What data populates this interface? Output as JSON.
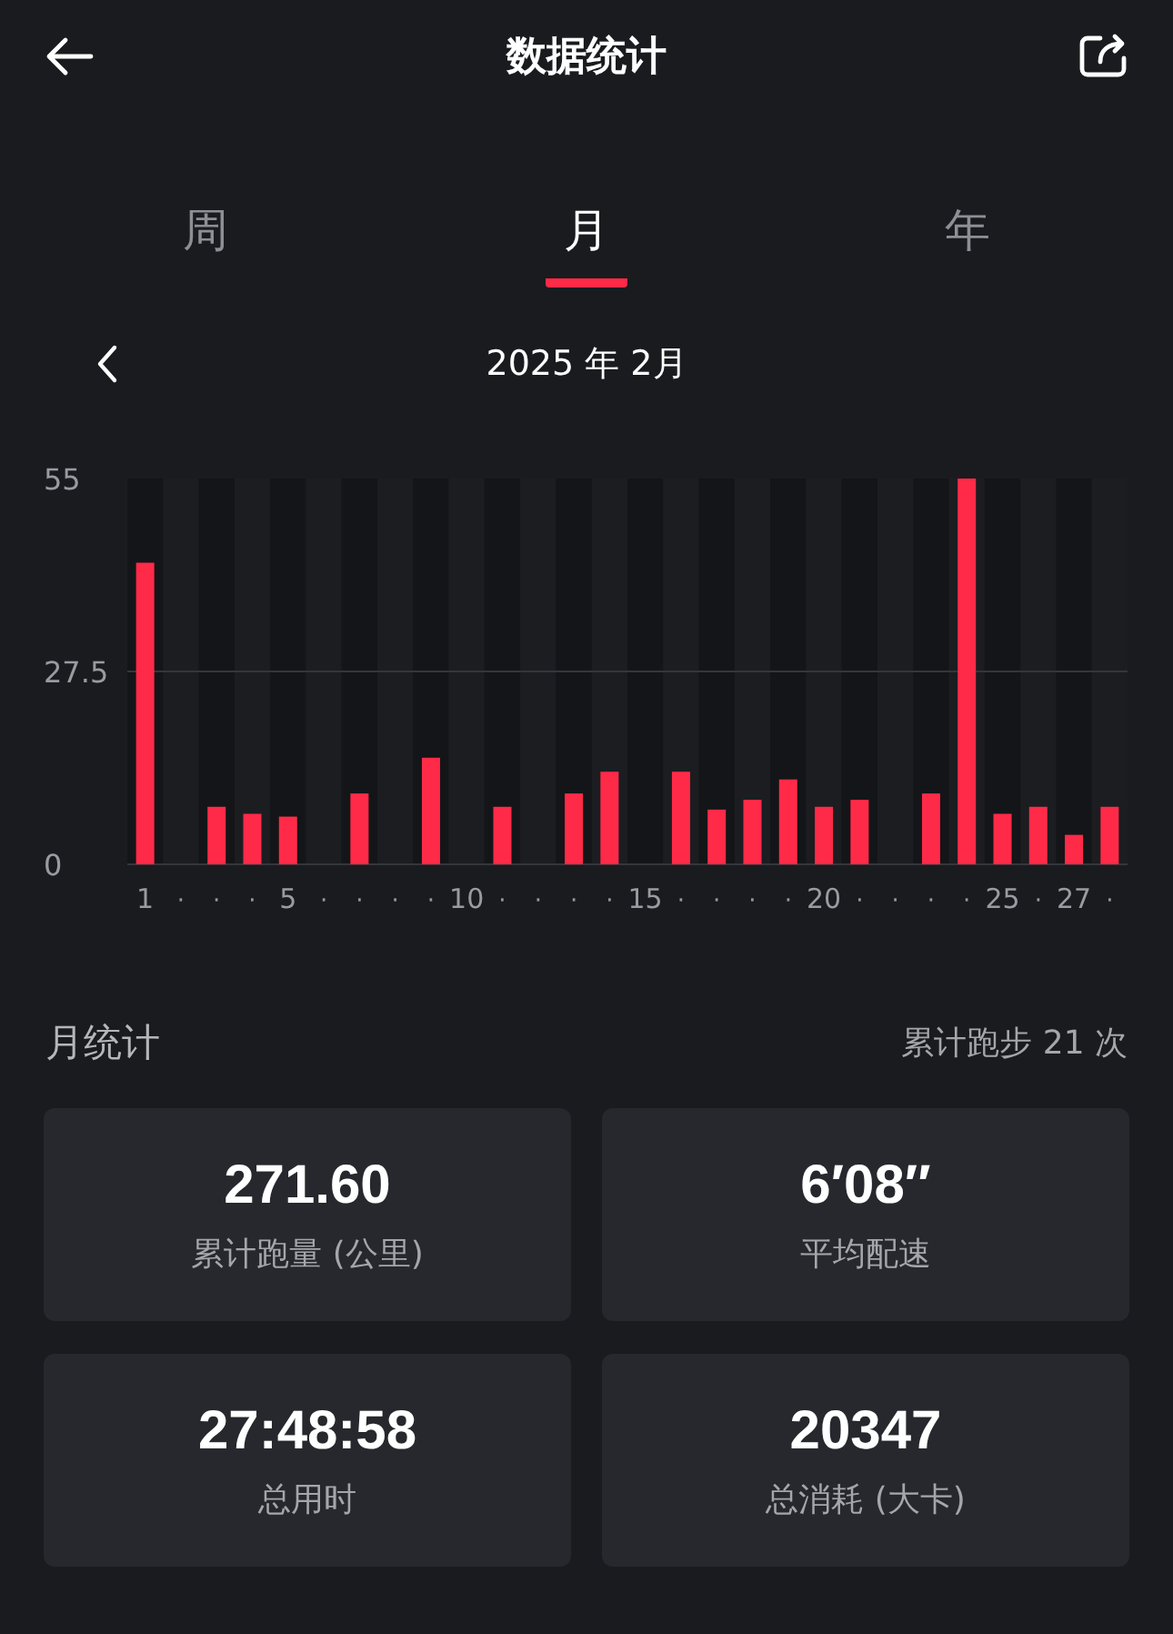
{
  "header": {
    "title": "数据统计"
  },
  "tabs": [
    {
      "label": "周",
      "selected": false
    },
    {
      "label": "月",
      "selected": true
    },
    {
      "label": "年",
      "selected": false
    }
  ],
  "period": {
    "label": "2025 年 2月"
  },
  "chart_data": {
    "type": "bar",
    "categories": [
      "1",
      "·",
      "·",
      "·",
      "5",
      "·",
      "·",
      "·",
      "·",
      "10",
      "·",
      "·",
      "·",
      "·",
      "15",
      "·",
      "·",
      "·",
      "·",
      "20",
      "·",
      "·",
      "·",
      "·",
      "25",
      "·",
      "27",
      "·"
    ],
    "values": [
      43,
      0,
      8.2,
      7.2,
      6.8,
      0,
      10.1,
      0,
      15.2,
      0,
      8.2,
      0,
      10.1,
      13.2,
      0,
      13.2,
      7.8,
      9.2,
      12.1,
      8.2,
      9.2,
      0,
      10.1,
      55,
      7.2,
      8.2,
      4.2,
      8.2
    ],
    "ylim": [
      0,
      55
    ],
    "yticks": [
      0,
      27.5,
      55
    ]
  },
  "summary": {
    "title": "月统计",
    "count": "累计跑步 21 次"
  },
  "stats": [
    {
      "value": "271.60",
      "label": "累计跑量 (公里)"
    },
    {
      "value": "6′08′′",
      "label": "平均配速"
    },
    {
      "value": "27:48:58",
      "label": "总用时"
    },
    {
      "value": "20347",
      "label": "总消耗 (大卡)"
    }
  ]
}
